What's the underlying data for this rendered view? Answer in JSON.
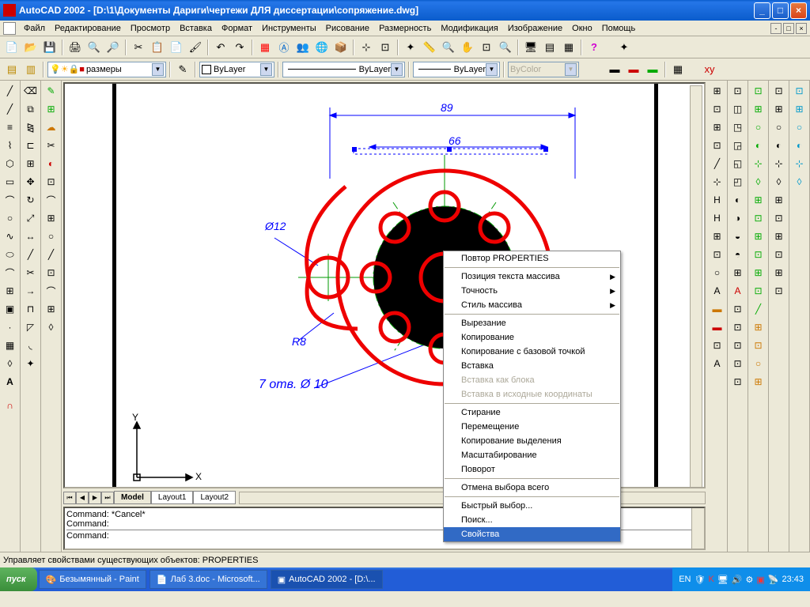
{
  "title": "AutoCAD 2002 - [D:\\1\\Документы Дариги\\чертежи ДЛЯ диссертации\\сопряжение.dwg]",
  "menu": [
    "Файл",
    "Редактирование",
    "Просмотр",
    "Вставка",
    "Формат",
    "Инструменты",
    "Рисование",
    "Размерность",
    "Модификация",
    "Изображение",
    "Окно",
    "Помощь"
  ],
  "layer_combo": "размеры",
  "bylayer1": "ByLayer",
  "bylayer2": "ByLayer",
  "bylayer3": "ByLayer",
  "bycolor": "ByColor",
  "tabs": {
    "model": "Model",
    "l1": "Layout1",
    "l2": "Layout2"
  },
  "cmd": {
    "l1": "Command: *Cancel*",
    "l2": "Command:",
    "l3": "Command:"
  },
  "status": "Управляет свойствами существующих объектов: PROPERTIES",
  "dim": {
    "d89": "89",
    "d66": "66",
    "d12": "Ø12",
    "r8": "R8",
    "holes": "7 отв. Ø 10"
  },
  "ctx": {
    "repeat": "Повтор PROPERTIES",
    "pos": "Позиция текста массива",
    "prec": "Точность",
    "style": "Стиль массива",
    "cut": "Вырезание",
    "copy": "Копирование",
    "copybase": "Копирование с базовой точкой",
    "paste": "Вставка",
    "pasteblock": "Вставка как блока",
    "pasteorig": "Вставка в исходные координаты",
    "erase": "Стирание",
    "move": "Перемещение",
    "copysel": "Копирование выделения",
    "scale": "Масштабирование",
    "rotate": "Поворот",
    "deselect": "Отмена выбора всего",
    "qselect": "Быстрый выбор...",
    "find": "Поиск...",
    "props": "Свойства"
  },
  "axis": {
    "x": "X",
    "y": "Y"
  },
  "task": {
    "start": "пуск",
    "t1": "Безымянный - Paint",
    "t2": "Лаб 3.doc - Microsoft...",
    "t3": "AutoCAD 2002 - [D:\\...",
    "lang": "EN",
    "clock": "23:43"
  }
}
